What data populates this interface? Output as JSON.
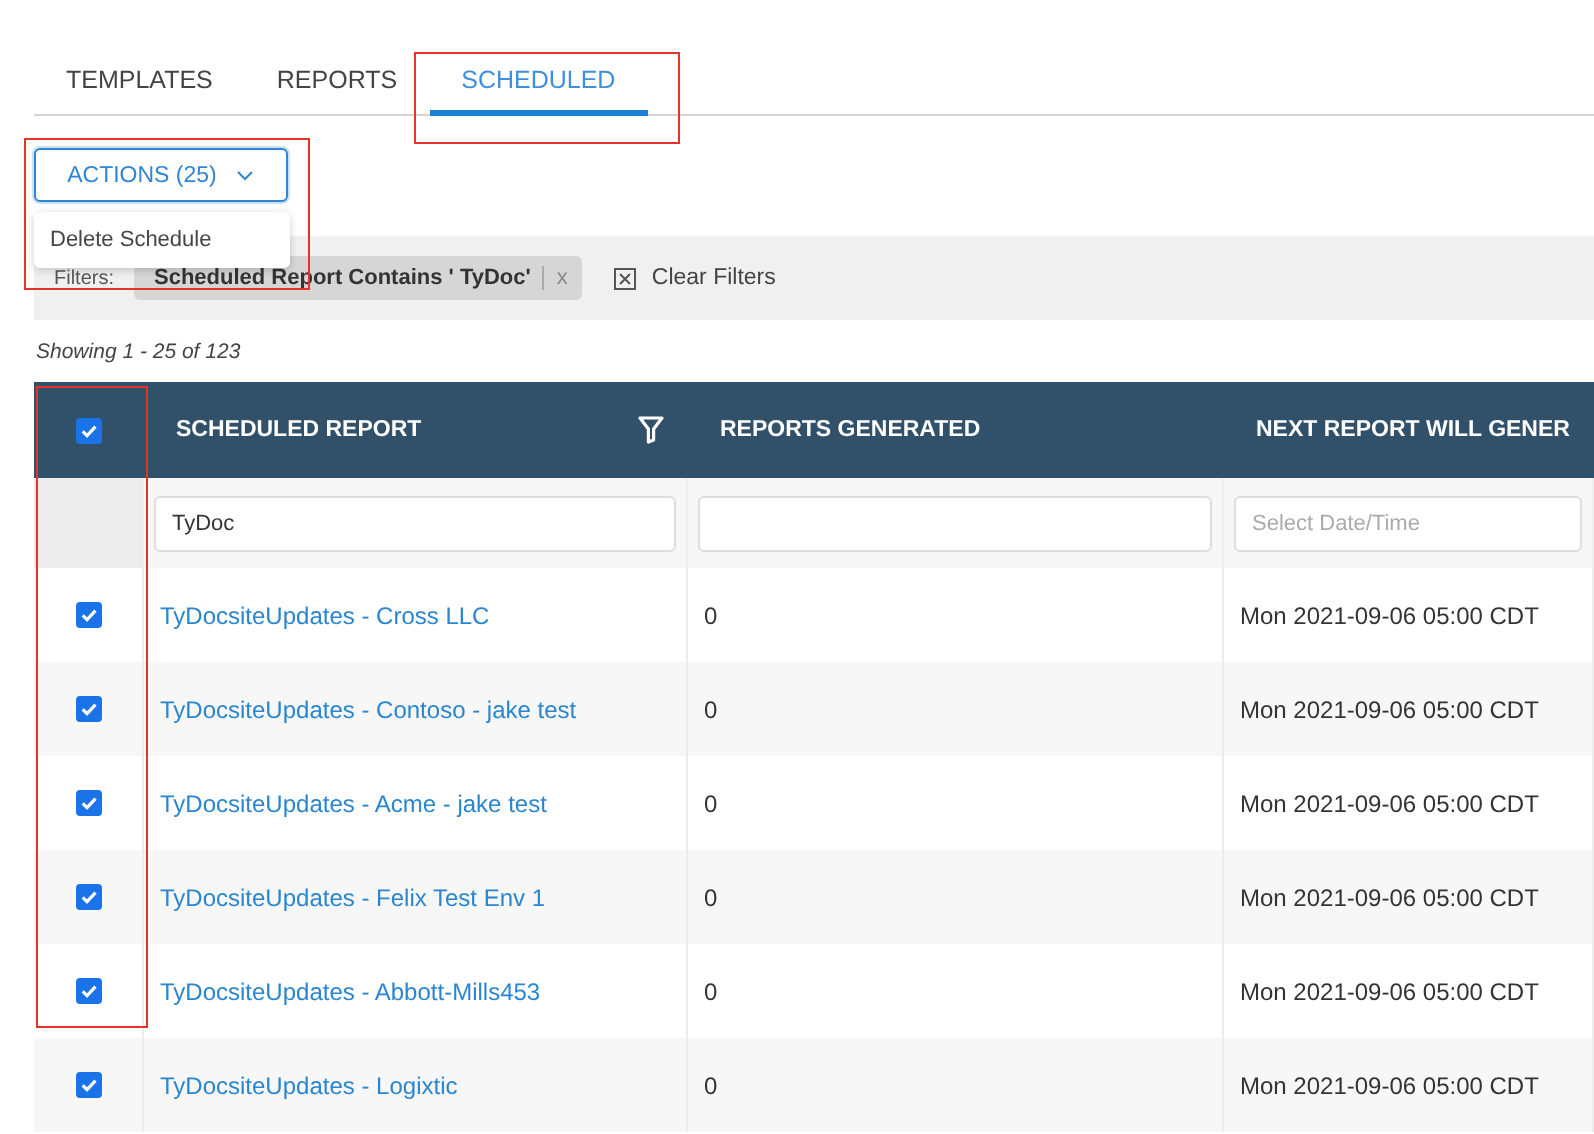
{
  "tabs": [
    {
      "label": "TEMPLATES",
      "selected": false
    },
    {
      "label": "REPORTS",
      "selected": false
    },
    {
      "label": "SCHEDULED",
      "selected": true
    }
  ],
  "actions": {
    "label": "ACTIONS (25)",
    "expanded": true,
    "menu": [
      "Delete Schedule"
    ]
  },
  "filters": {
    "label": "Filters:",
    "chips": [
      "Scheduled Report Contains ' TyDoc'"
    ],
    "chip_remove": "x",
    "clear": "Clear Filters"
  },
  "showing": "Showing 1 - 25 of 123",
  "table": {
    "all_checked": true,
    "columns": [
      {
        "label": "SCHEDULED REPORT",
        "filter": "TyDoc",
        "kind": "text"
      },
      {
        "label": "REPORTS GENERATED",
        "kind": "text"
      },
      {
        "label": "NEXT REPORT WILL GENER",
        "placeholder": "Select Date/Time",
        "kind": "date"
      }
    ],
    "rows": [
      {
        "checked": true,
        "name": "TyDocsiteUpdates - Cross LLC",
        "generated": "0",
        "next": "Mon 2021-09-06 05:00 CDT"
      },
      {
        "checked": true,
        "name": "TyDocsiteUpdates - Contoso - jake test",
        "generated": "0",
        "next": "Mon 2021-09-06 05:00 CDT"
      },
      {
        "checked": true,
        "name": "TyDocsiteUpdates - Acme - jake test",
        "generated": "0",
        "next": "Mon 2021-09-06 05:00 CDT"
      },
      {
        "checked": true,
        "name": "TyDocsiteUpdates - Felix Test Env 1",
        "generated": "0",
        "next": "Mon 2021-09-06 05:00 CDT"
      },
      {
        "checked": true,
        "name": "TyDocsiteUpdates - Abbott-Mills453",
        "generated": "0",
        "next": "Mon 2021-09-06 05:00 CDT"
      },
      {
        "checked": true,
        "name": "TyDocsiteUpdates - Logixtic",
        "generated": "0",
        "next": "Mon 2021-09-06 05:00 CDT"
      }
    ]
  }
}
